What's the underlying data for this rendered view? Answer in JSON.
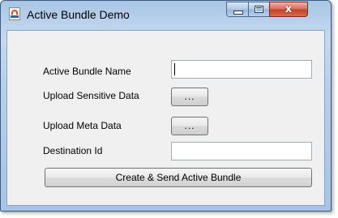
{
  "window": {
    "title": "Active Bundle Demo",
    "app_icon": "java-cup-icon",
    "controls": {
      "minimize": "minimize-icon",
      "maximize": "maximize-icon",
      "close_glyph": "x"
    }
  },
  "form": {
    "bundle_name": {
      "label": "Active Bundle Name",
      "value": ""
    },
    "sensitive_data": {
      "label": "Upload Sensitive Data",
      "button_label": "..."
    },
    "meta_data": {
      "label": "Upload Meta Data",
      "button_label": "..."
    },
    "destination": {
      "label": "Destination Id",
      "value": ""
    },
    "submit_label": "Create & Send Active Bundle"
  },
  "colors": {
    "title_bar": "#b7cfea",
    "close_button": "#c4432a",
    "client_background": "#f0f0f0"
  }
}
